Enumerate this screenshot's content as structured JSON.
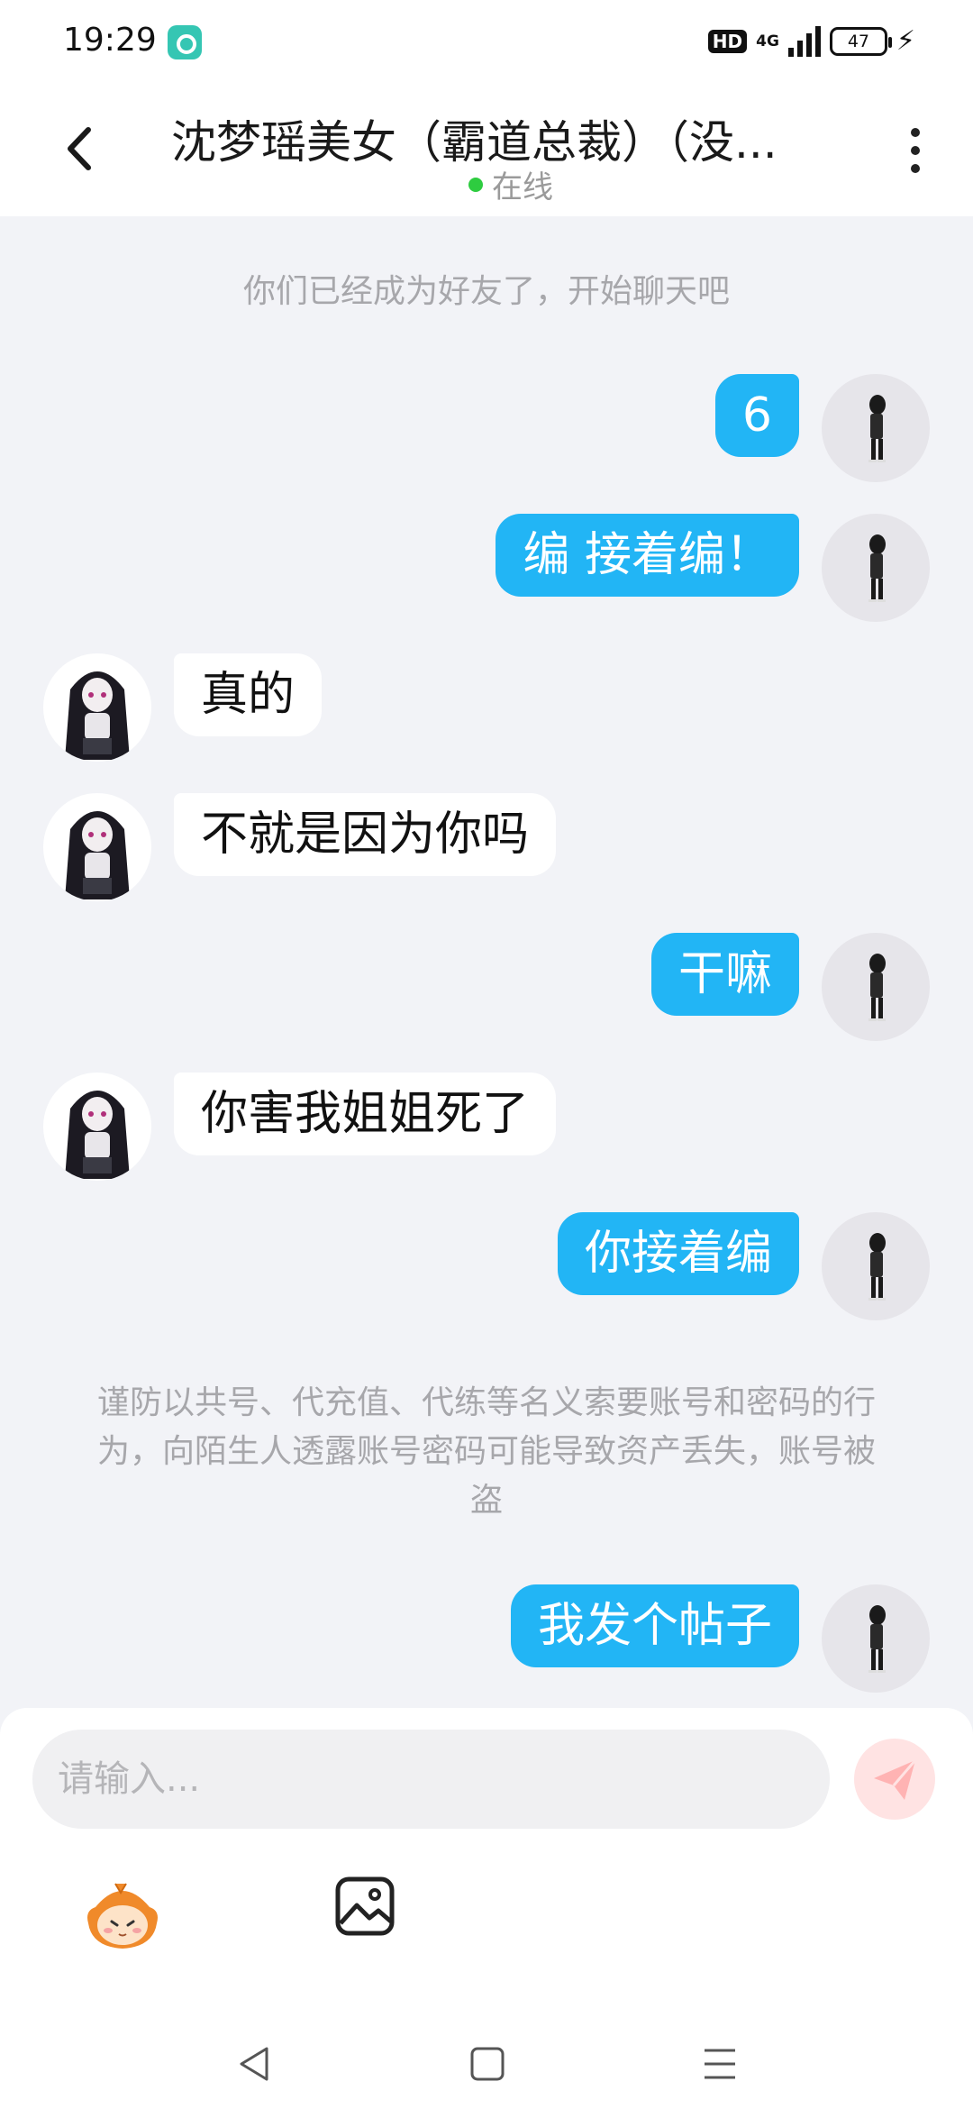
{
  "status_bar": {
    "time": "19:29",
    "hd": "HD",
    "network": "4G",
    "battery": "47"
  },
  "header": {
    "title": "沈梦瑶美女（霸道总裁）（没...",
    "status": "在线"
  },
  "chat": {
    "friend_note": "你们已经成为好友了，开始聊天吧",
    "messages": [
      {
        "sender": "me",
        "text": "6"
      },
      {
        "sender": "me",
        "text": "编  接着编！"
      },
      {
        "sender": "other",
        "text": "真的"
      },
      {
        "sender": "other",
        "text": "不就是因为你吗"
      },
      {
        "sender": "me",
        "text": "干嘛"
      },
      {
        "sender": "other",
        "text": "你害我姐姐死了"
      },
      {
        "sender": "me",
        "text": "你接着编"
      },
      {
        "sender": "me",
        "text": "我发个帖子"
      }
    ],
    "security_warning": "谨防以共号、代充值、代练等名义索要账号和密码的行为，向陌生人透露账号密码可能导致资产丢失，账号被盗"
  },
  "input": {
    "placeholder": "请输入..."
  },
  "colors": {
    "sent_bubble": "#22b5f5",
    "received_bubble": "#ffffff",
    "background": "#f2f3f7",
    "online_dot": "#2ecc40",
    "send_button": "#ff9a9a"
  },
  "icons": {
    "back": "chevron-left-icon",
    "more": "more-vertical-icon",
    "send": "send-icon",
    "emoji": "emoji-mascot-icon",
    "image": "image-icon",
    "nav_back": "nav-back-icon",
    "nav_home": "nav-home-icon",
    "nav_menu": "nav-menu-icon"
  }
}
